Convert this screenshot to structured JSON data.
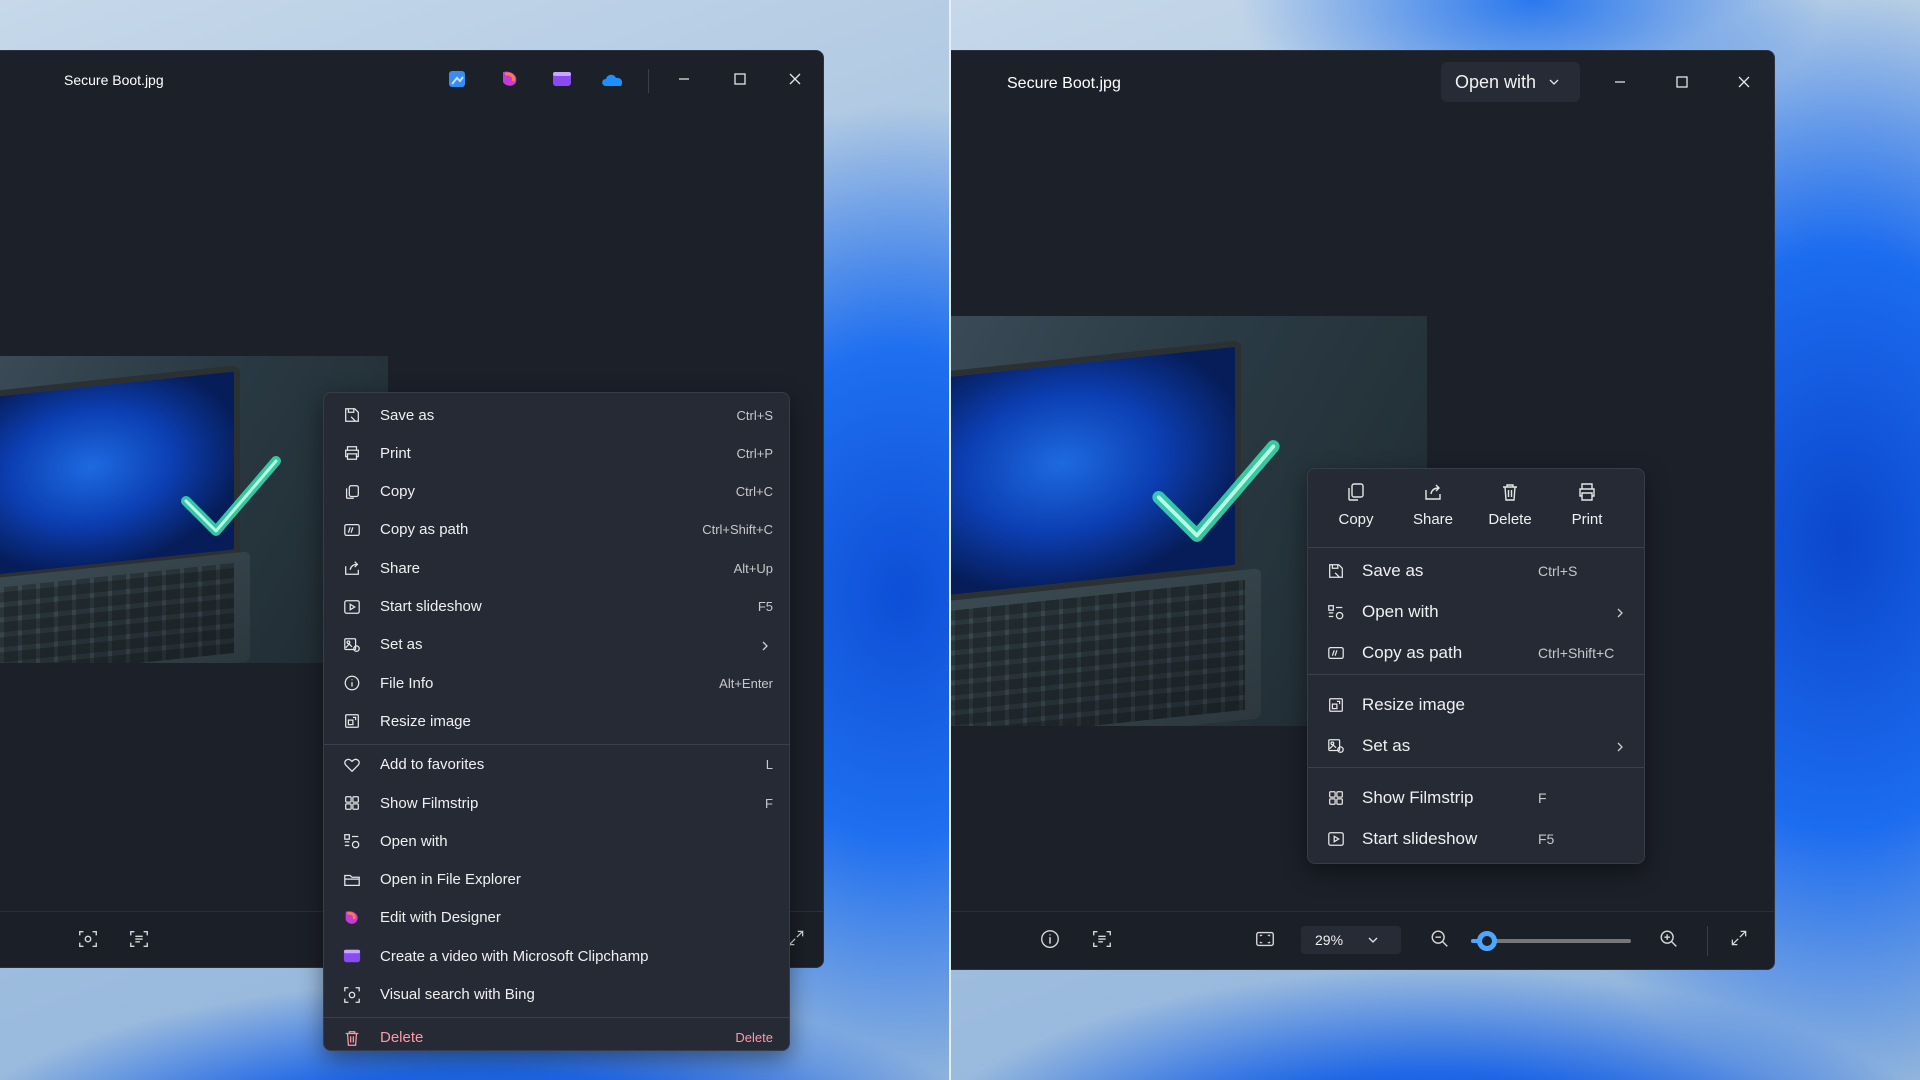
{
  "left_window": {
    "title": "Secure Boot.jpg",
    "context_menu": [
      {
        "label": "Save as",
        "shortcut": "Ctrl+S",
        "icon": "save-as-icon"
      },
      {
        "label": "Print",
        "shortcut": "Ctrl+P",
        "icon": "printer-icon"
      },
      {
        "label": "Copy",
        "shortcut": "Ctrl+C",
        "icon": "copy-icon"
      },
      {
        "label": "Copy as path",
        "shortcut": "Ctrl+Shift+C",
        "icon": "copy-path-icon"
      },
      {
        "label": "Share",
        "shortcut": "Alt+Up",
        "icon": "share-icon"
      },
      {
        "label": "Start slideshow",
        "shortcut": "F5",
        "icon": "slideshow-icon"
      },
      {
        "label": "Set as",
        "shortcut": "",
        "icon": "set-as-icon",
        "submenu": true
      },
      {
        "label": "File Info",
        "shortcut": "Alt+Enter",
        "icon": "info-icon"
      },
      {
        "label": "Resize image",
        "shortcut": "",
        "icon": "resize-icon"
      },
      {
        "label": "Add to favorites",
        "shortcut": "L",
        "icon": "heart-icon"
      },
      {
        "label": "Show Filmstrip",
        "shortcut": "F",
        "icon": "filmstrip-icon"
      },
      {
        "label": "Open with",
        "shortcut": "",
        "icon": "open-with-icon"
      },
      {
        "label": "Open in File Explorer",
        "shortcut": "",
        "icon": "folder-icon"
      },
      {
        "label": "Edit with Designer",
        "shortcut": "",
        "icon": "designer-icon"
      },
      {
        "label": "Create a video with Microsoft Clipchamp",
        "shortcut": "",
        "icon": "clipchamp-icon"
      },
      {
        "label": "Visual search with Bing",
        "shortcut": "",
        "icon": "visual-search-icon"
      },
      {
        "label": "Delete",
        "shortcut": "Delete",
        "icon": "trash-icon"
      }
    ]
  },
  "right_window": {
    "title": "Secure Boot.jpg",
    "open_with_label": "Open with",
    "quick_actions": [
      {
        "label": "Copy",
        "icon": "copy-icon"
      },
      {
        "label": "Share",
        "icon": "share-icon"
      },
      {
        "label": "Delete",
        "icon": "trash-icon"
      },
      {
        "label": "Print",
        "icon": "printer-icon"
      }
    ],
    "context_menu": [
      {
        "label": "Save as",
        "shortcut": "Ctrl+S",
        "icon": "save-as-icon"
      },
      {
        "label": "Open with",
        "shortcut": "",
        "icon": "open-with-icon",
        "submenu": true
      },
      {
        "label": "Copy as path",
        "shortcut": "Ctrl+Shift+C",
        "icon": "copy-path-icon"
      },
      {
        "label": "Resize image",
        "shortcut": "",
        "icon": "resize-icon"
      },
      {
        "label": "Set as",
        "shortcut": "",
        "icon": "set-as-icon",
        "submenu": true
      },
      {
        "label": "Show Filmstrip",
        "shortcut": "F",
        "icon": "filmstrip-icon"
      },
      {
        "label": "Start slideshow",
        "shortcut": "F5",
        "icon": "slideshow-icon"
      }
    ],
    "zoom": "29%",
    "zoom_slider_fraction": 0.1
  },
  "colors": {
    "window_bg": "#1c2029",
    "menu_bg": "#252a34",
    "accent": "#4fa6ff",
    "danger": "#ff99a4"
  }
}
